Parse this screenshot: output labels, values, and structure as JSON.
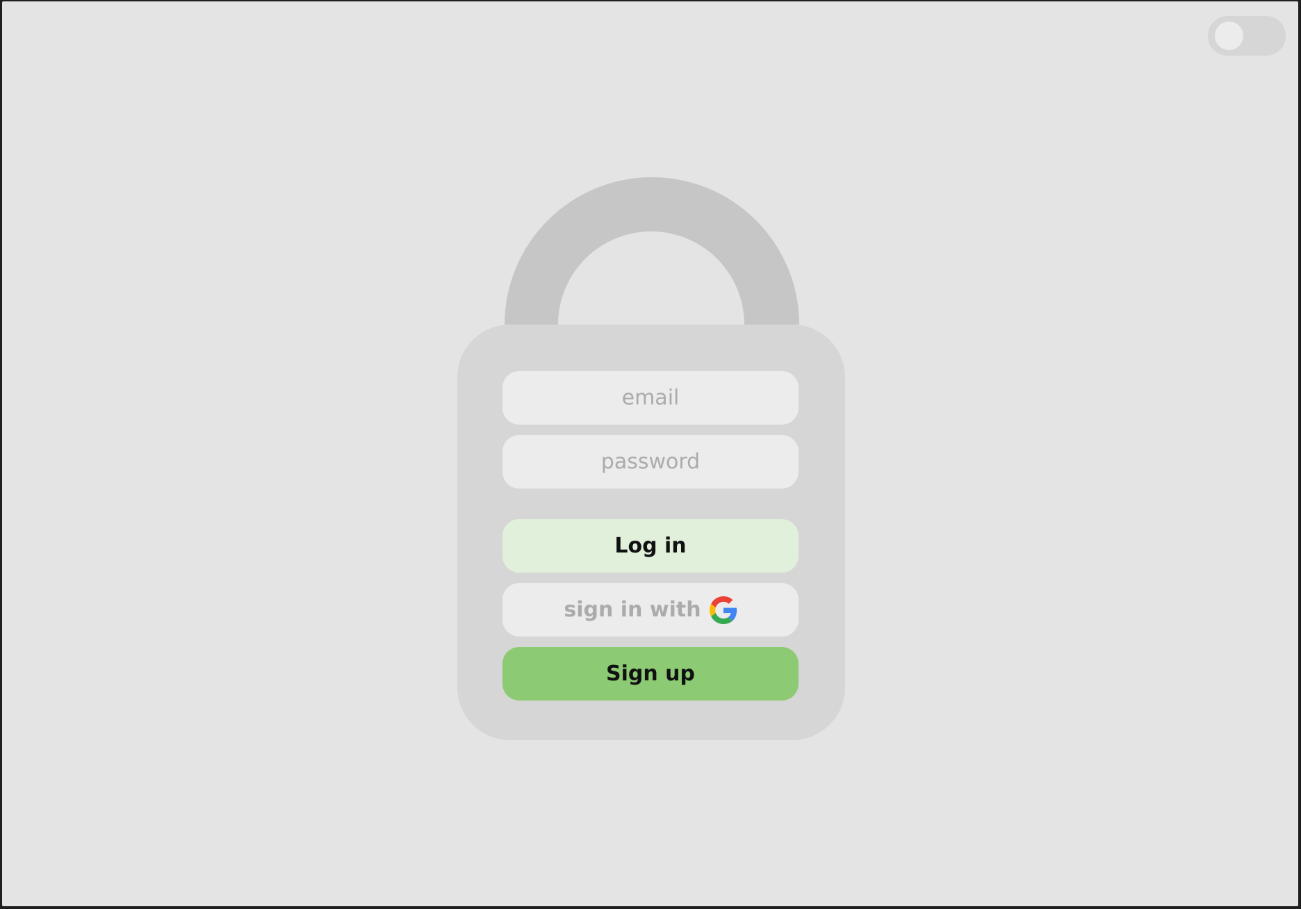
{
  "theme_toggle": {
    "state": "off"
  },
  "login_form": {
    "email": {
      "placeholder": "email",
      "value": ""
    },
    "password": {
      "placeholder": "password",
      "value": ""
    },
    "login_label": "Log in",
    "google_label": "sign in with",
    "google_icon": "google-g-icon",
    "signup_label": "Sign up"
  },
  "colors": {
    "background": "#e4e4e4",
    "lock_shackle": "#c6c6c6",
    "lock_body": "#d6d6d6",
    "field_bg": "#ececec",
    "login_bg": "#e1f0db",
    "signup_bg": "#8dca74",
    "placeholder_text": "#ababab",
    "button_text": "#111111"
  }
}
